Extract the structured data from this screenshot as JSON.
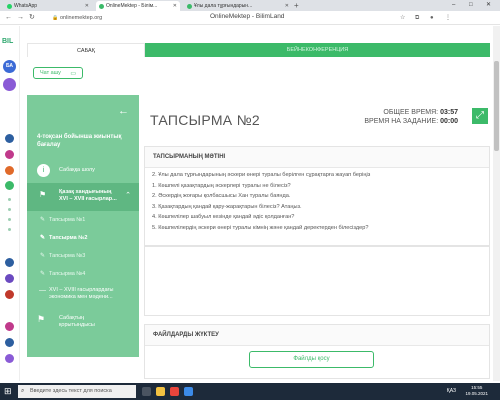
{
  "browser": {
    "tabs": [
      {
        "title": "WhatsApp",
        "color": "#25d366"
      },
      {
        "title": "OnlineMektep - Білім...",
        "color": "#3cba69"
      },
      {
        "title": "Ұлы дала тұрғындарын...",
        "color": "#3cba69"
      }
    ],
    "new_tab": "+",
    "min": "–",
    "max": "□",
    "close": "✕",
    "url": "onlinemektep.org",
    "page_title": "OnlineMektep - BilimLand"
  },
  "rail": {
    "logo": "BIL",
    "avatar_initials": "БА"
  },
  "subtabs": {
    "lesson": "САБАҚ",
    "video": "БЕЙНЕКОНФЕРЕНЦИЯ"
  },
  "chat": {
    "label": "Чат ашу",
    "icon": "chat-icon"
  },
  "sidebar": {
    "title": "4-тоқсан бойынша жиынтық бағалау",
    "items": [
      {
        "label": "Сабаққа шолу",
        "icon": "info-icon"
      },
      {
        "label": "Қазақ хандығының XVI – XVII ғасырлар...",
        "icon": "flag-icon"
      }
    ],
    "subitems": [
      {
        "label": "Тапсырма №1"
      },
      {
        "label": "Тапсырма №2"
      },
      {
        "label": "Тапсырма №3"
      },
      {
        "label": "Тапсырма №4"
      }
    ],
    "items2": [
      {
        "label": "XVI – XVIII ғасырлардағы экономика мен мәдени..."
      },
      {
        "label": "Сабақтың қорытындысы",
        "icon": "flag-icon"
      }
    ]
  },
  "main": {
    "title": "ТАПСЫРМА №2",
    "total_time_label": "ОБЩЕЕ ВРЕМЯ:",
    "total_time": "03:57",
    "task_time_label": "ВРЕМЯ НА ЗАДАНИЕ:",
    "task_time": "00:00",
    "task_text_header": "ТАПСЫРМАНЫҢ МӘТІНІ",
    "task_lines": [
      "2. Ұлы дала тұрғындарының әскери өнері туралы берілген сұрақтарға жауап беріңіз",
      "1. Көшпелі қазақтардың әскерлері туралы не білесіз?",
      "2. Әскердің жоғары қолбасшысы Хан туралы баянда.",
      "3. Қазақтардың қандай қару-жарақтарын білесіз? Атаңыз.",
      "4. Көшпелілер шабуыл кезінде қандай әдіс қолданған?",
      "5. Көшпелілердің әскери өнері туралы кімнің және қандай деректерден білесіздер?"
    ],
    "upload_header": "ФАЙЛДАРДЫ ЖҮКТЕУ",
    "upload_button": "Файлды қосу"
  },
  "taskbar": {
    "search_placeholder": "Введите здесь текст для поиска",
    "lang": "ҚАЗ",
    "time": "15:55",
    "date": "19.05.2021"
  }
}
